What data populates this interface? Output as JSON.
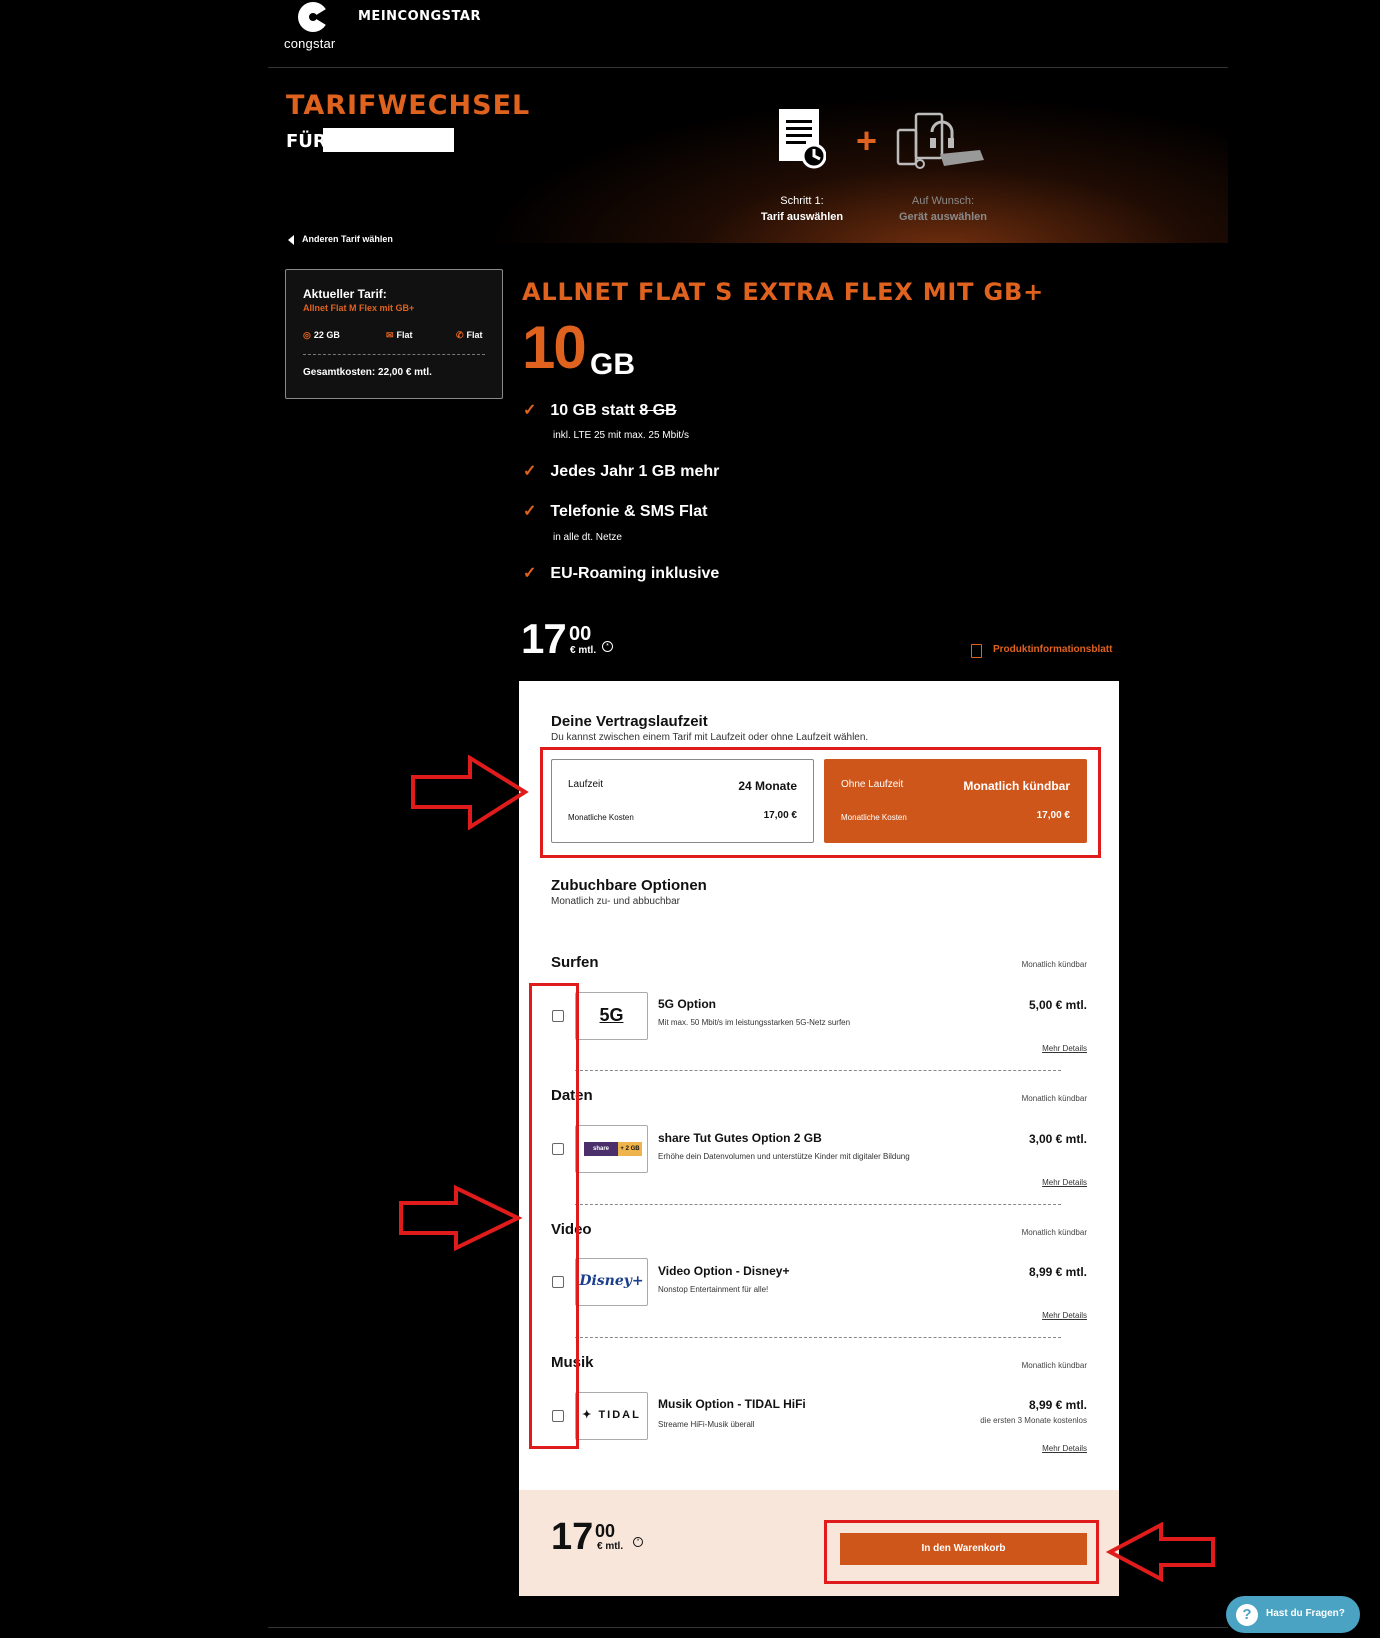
{
  "header": {
    "brand": "congstar",
    "nav_label": "MEINCONGSTAR"
  },
  "hero": {
    "title": "TARIFWECHSEL",
    "for_label": "FÜR",
    "steps": [
      {
        "line1": "Schritt 1:",
        "line2": "Tarif auswählen",
        "active": true
      },
      {
        "line1": "Auf Wunsch:",
        "line2": "Gerät auswählen",
        "active": false
      }
    ],
    "plus": "+"
  },
  "back_link": "Anderen Tarif wählen",
  "current_tariff": {
    "title": "Aktueller Tarif:",
    "name": "Allnet Flat M Flex mit GB+",
    "features": [
      "22 GB",
      "Flat",
      "Flat"
    ],
    "total": "Gesamtkosten: 22,00 € mtl."
  },
  "product": {
    "title": "ALLNET FLAT S EXTRA FLEX MIT GB+",
    "data_amount": "10",
    "data_unit": "GB",
    "features": [
      {
        "text": "10 GB statt ",
        "strike": "8 GB",
        "sub": "inkl. LTE 25 mit max. 25 Mbit/s"
      },
      {
        "text": "Jedes Jahr 1 GB mehr",
        "strike": "",
        "sub": ""
      },
      {
        "text": "Telefonie & SMS Flat",
        "strike": "",
        "sub": "in alle dt. Netze"
      },
      {
        "text": "EU-Roaming inklusive",
        "strike": "",
        "sub": ""
      }
    ],
    "price_int": "17",
    "price_dec": "00",
    "price_unit": "€ mtl.",
    "info_mark": "*",
    "info_sheet": "Produktinformationsblatt"
  },
  "contract": {
    "heading": "Deine Vertragslaufzeit",
    "sub": "Du kannst zwischen einem Tarif mit Laufzeit oder ohne Laufzeit wählen.",
    "options": [
      {
        "label": "Laufzeit",
        "value": "24 Monate",
        "cost_label": "Monatliche Kosten",
        "cost": "17,00 €",
        "selected": false
      },
      {
        "label": "Ohne Laufzeit",
        "value": "Monatlich kündbar",
        "cost_label": "Monatliche Kosten",
        "cost": "17,00 €",
        "selected": true
      }
    ]
  },
  "addons": {
    "heading": "Zubuchbare Optionen",
    "sub": "Monatlich zu- und abbuchbar",
    "categories": [
      {
        "name": "Surfen",
        "right": "Monatlich kündbar",
        "logo": "5G",
        "title": "5G Option",
        "desc": "Mit max. 50 Mbit/s im leistungsstarken 5G-Netz surfen",
        "price": "5,00 € mtl.",
        "price_note": "",
        "more": "Mehr Details"
      },
      {
        "name": "Daten",
        "right": "Monatlich kündbar",
        "logo": "share",
        "logo_extra": "+ 2 GB",
        "title": "share Tut Gutes Option 2 GB",
        "desc": "Erhöhe dein Datenvolumen und unterstütze Kinder mit digitaler Bildung",
        "price": "3,00 € mtl.",
        "price_note": "",
        "more": "Mehr Details"
      },
      {
        "name": "Video",
        "right": "Monatlich kündbar",
        "logo": "Disney+",
        "title": "Video Option - Disney+",
        "desc": "Nonstop Entertainment für alle!",
        "price": "8,99 € mtl.",
        "price_note": "",
        "more": "Mehr Details"
      },
      {
        "name": "Musik",
        "right": "Monatlich kündbar",
        "logo": "TIDAL",
        "title": "Musik Option - TIDAL HiFi",
        "desc": "Streame HiFi-Musik überall",
        "price": "8,99 € mtl.",
        "price_note": "die ersten 3 Monate kostenlos",
        "more": "Mehr Details"
      }
    ]
  },
  "footer": {
    "price_int": "17",
    "price_dec": "00",
    "price_unit": "€ mtl.",
    "info_mark": "*",
    "cart_button": "In den Warenkorb"
  },
  "help": {
    "label": "Hast du Fragen?",
    "icon": "?"
  },
  "colors": {
    "accent": "#e0621f",
    "button": "#cf561a",
    "annotation": "#e01b1b",
    "help": "#4aa3c3"
  }
}
